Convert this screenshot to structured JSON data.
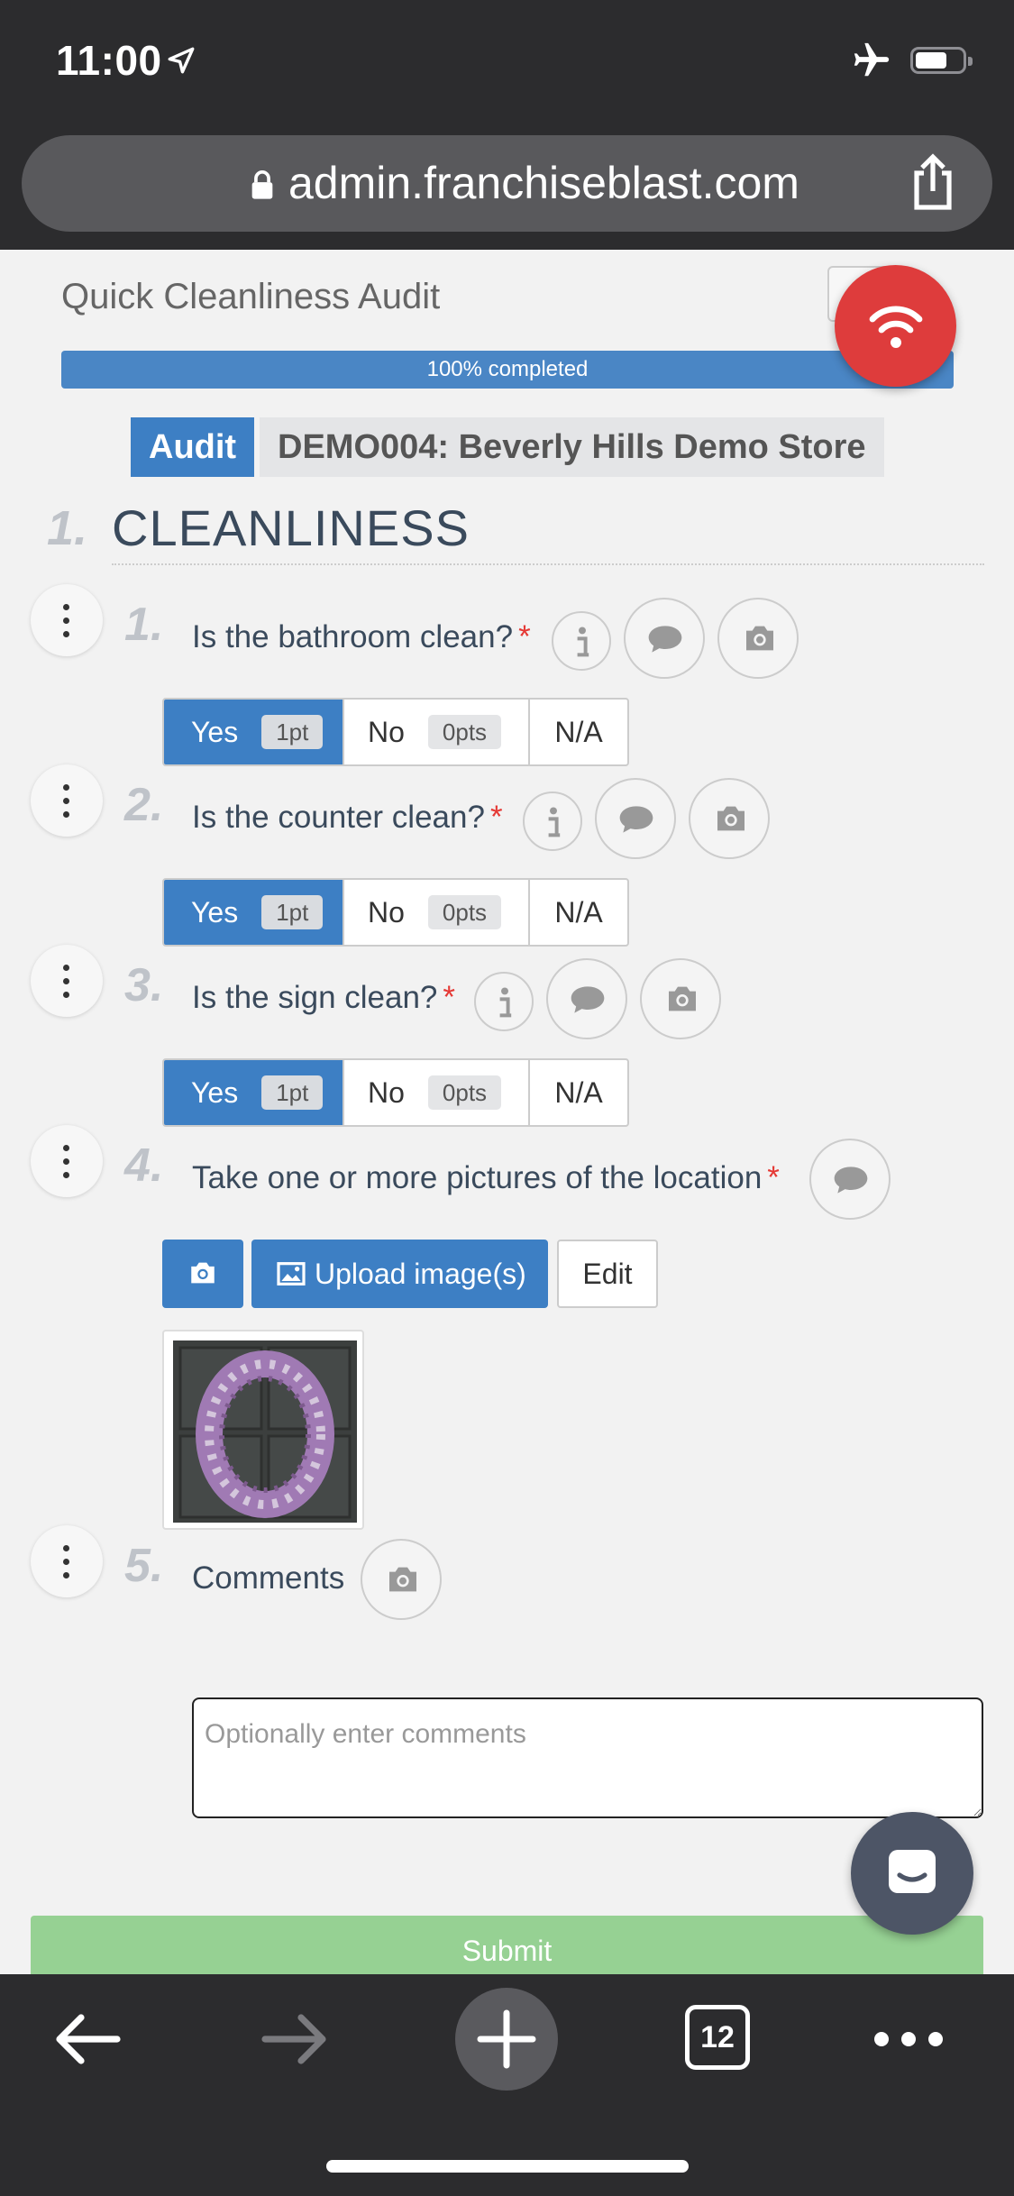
{
  "status_bar": {
    "time": "11:00"
  },
  "browser": {
    "url": "admin.franchiseblast.com",
    "tab_count": "12"
  },
  "audit": {
    "title": "Quick Cleanliness Audit",
    "progress_text": "100% completed",
    "progress_fraction": 1.0,
    "type_badge": "Audit",
    "store_badge": "DEMO004: Beverly Hills Demo Store"
  },
  "section": {
    "number": "1.",
    "title": "CLEANLINESS"
  },
  "questions": [
    {
      "number": "1.",
      "text": "Is the bathroom clean?",
      "required": "*",
      "options": [
        {
          "label": "Yes",
          "pts": "1pt",
          "selected": true
        },
        {
          "label": "No",
          "pts": "0pts"
        },
        {
          "label": "N/A"
        }
      ]
    },
    {
      "number": "2.",
      "text": "Is the counter clean?",
      "required": "*",
      "options": [
        {
          "label": "Yes",
          "pts": "1pt",
          "selected": true
        },
        {
          "label": "No",
          "pts": "0pts"
        },
        {
          "label": "N/A"
        }
      ]
    },
    {
      "number": "3.",
      "text": "Is the sign clean?",
      "required": "*",
      "options": [
        {
          "label": "Yes",
          "pts": "1pt",
          "selected": true
        },
        {
          "label": "No",
          "pts": "0pts"
        },
        {
          "label": "N/A"
        }
      ]
    },
    {
      "number": "4.",
      "text": "Take one or more pictures of the location",
      "required": "*",
      "upload_label": "Upload image(s)",
      "edit_label": "Edit"
    },
    {
      "number": "5.",
      "text": "Comments",
      "placeholder": "Optionally enter comments"
    }
  ],
  "submit_label": "Submit",
  "colors": {
    "primary": "#3d7fc4",
    "wifi_fab": "#de3c3c",
    "submit": "#96d193",
    "chrome": "#2c2c2e"
  }
}
